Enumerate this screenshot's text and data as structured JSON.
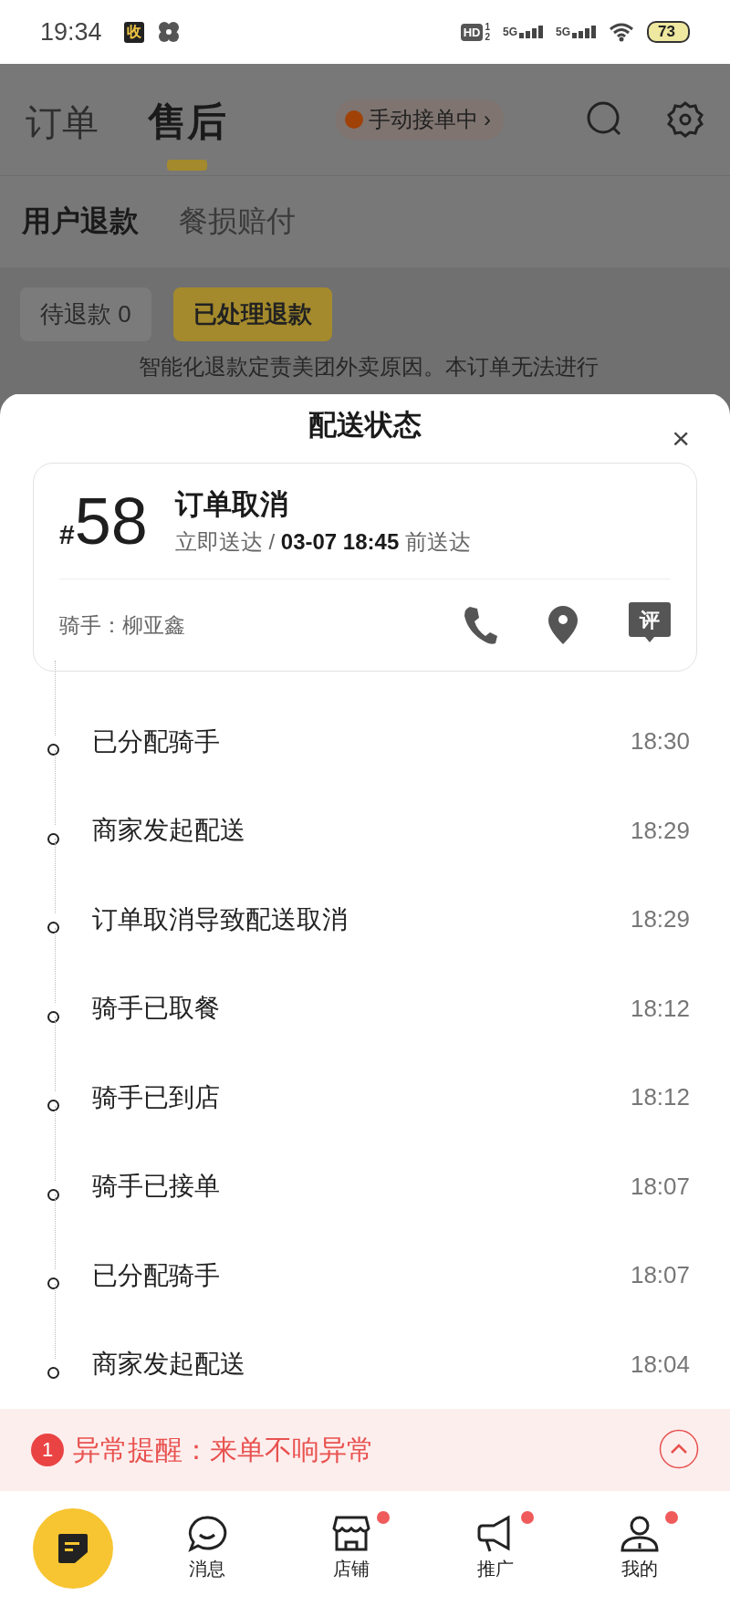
{
  "status_bar": {
    "time": "19:34",
    "app_badge": "收",
    "hd": "HD",
    "sims": [
      "1",
      "2"
    ],
    "networks": [
      "5G",
      "5G"
    ],
    "battery": "73"
  },
  "header": {
    "tabs": [
      {
        "label": "订单",
        "selected": false
      },
      {
        "label": "售后",
        "selected": true
      }
    ],
    "status_pill": {
      "label": "手动接单中",
      "chevron": "›"
    }
  },
  "subtabs": [
    {
      "label": "用户退款",
      "selected": true
    },
    {
      "label": "餐损赔付",
      "selected": false
    }
  ],
  "filters": [
    {
      "label": "待退款 0",
      "selected": false
    },
    {
      "label": "已处理退款",
      "selected": true
    }
  ],
  "notice_line": "智能化退款定责美团外卖原因。本订单无法进行",
  "sheet": {
    "title": "配送状态",
    "close": "×",
    "order": {
      "hash": "#",
      "number": "58",
      "title": "订单取消",
      "schedule": "立即送达 / **03-07 18:45** 前送达",
      "rider": "骑手：柳亚鑫",
      "review_label": "评"
    },
    "events": [
      {
        "label": "已分配骑手",
        "time": "18:30"
      },
      {
        "label": "商家发起配送",
        "time": "18:29"
      },
      {
        "label": "订单取消导致配送取消",
        "time": "18:29"
      },
      {
        "label": "骑手已取餐",
        "time": "18:12"
      },
      {
        "label": "骑手已到店",
        "time": "18:12"
      },
      {
        "label": "骑手已接单",
        "time": "18:07"
      },
      {
        "label": "已分配骑手",
        "time": "18:07"
      },
      {
        "label": "商家发起配送",
        "time": "18:04"
      }
    ]
  },
  "alert": {
    "count": "1",
    "text": "异常提醒：来单不响异常"
  },
  "nav": [
    {
      "kind": "home"
    },
    {
      "kind": "chat",
      "label": "消息",
      "badge": false
    },
    {
      "kind": "store",
      "label": "店铺",
      "badge": true
    },
    {
      "kind": "promo",
      "label": "推广",
      "badge": true
    },
    {
      "kind": "profile",
      "label": "我的",
      "badge": true
    }
  ]
}
